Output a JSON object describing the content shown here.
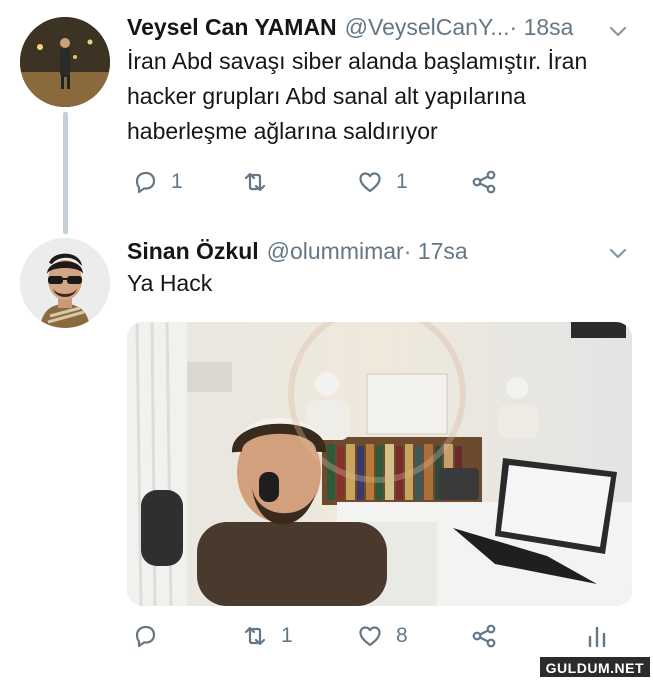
{
  "tweets": [
    {
      "name": "Veysel Can YAMAN",
      "handle": "@VeyselCanY...",
      "time": " · 18sa",
      "text": "İran Abd savaşı siber alanda başlamıştır. İran hacker grupları Abd sanal alt yapılarına haberleşme ağlarına saldırıyor",
      "replies": "1",
      "retweets": "",
      "likes": "1"
    },
    {
      "name": "Sinan Özkul",
      "handle": "@olummimar",
      "time": " · 17sa",
      "text": "Ya Hack",
      "replies": "",
      "retweets": "1",
      "likes": "8"
    }
  ],
  "watermark": "GULDUM.NET",
  "colors": {
    "text": "#14171a",
    "muted": "#657786",
    "thread_line": "#c4cfd6"
  },
  "icons": [
    "reply-icon",
    "retweet-icon",
    "like-icon",
    "share-icon",
    "analytics-icon",
    "chevron-down-icon"
  ]
}
